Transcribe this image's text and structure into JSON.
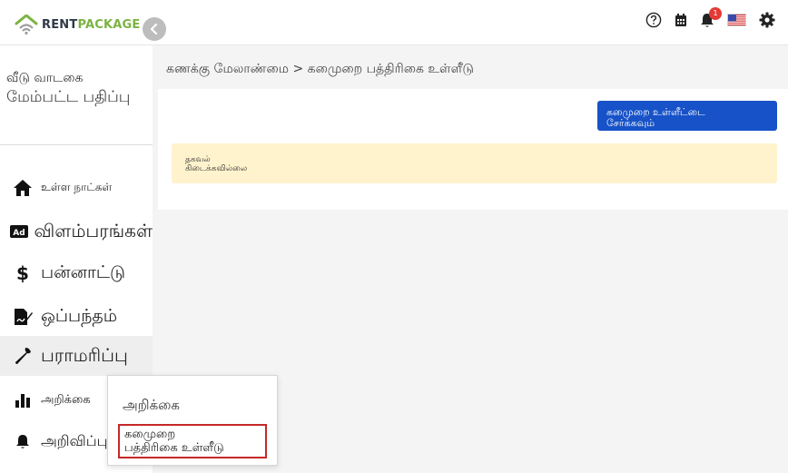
{
  "brand": {
    "rent": "RENT",
    "package": "PACKAGE"
  },
  "header": {
    "notifications_count": "1",
    "icons": [
      "help-circle-icon",
      "calendar-icon",
      "bell-icon",
      "us-flag-icon",
      "gear-icon"
    ]
  },
  "sidebar": {
    "user": {
      "line1": "வீடு வாடகை",
      "line2": "மேம்பட்ட பதிப்பு"
    },
    "items": [
      {
        "label": "உள்ள நாட்கள்",
        "icon": "home-icon"
      },
      {
        "label": "விளம்பரங்கள்",
        "icon": "ad-icon"
      },
      {
        "label": "பன்னாட்டு",
        "icon": "dollar-icon"
      },
      {
        "label": "ஒப்பந்தம்",
        "icon": "contract-icon"
      },
      {
        "label": "பராமரிப்பு",
        "icon": "wrench-icon"
      },
      {
        "label": "அறிக்கை",
        "icon": "bar-chart-icon"
      },
      {
        "label": "அறிவிப்பு",
        "icon": "bell-icon"
      }
    ]
  },
  "main": {
    "breadcrumb": "கணக்கு மேலாண்மை > கமைுறை பத்திரிகை உள்ளீடு",
    "action_button": {
      "line1": "கமைுறை உள்ளீட்டை",
      "line2": "சேர்க்கவும்"
    },
    "alert": {
      "title": "தகவல்",
      "message": "கிடைக்கவில்லை"
    }
  },
  "dropdown": {
    "items": [
      {
        "label": "அறிக்கை"
      },
      {
        "line1": "கமைுறை",
        "line2": "பத்திரிகை உள்ளீடு"
      }
    ]
  },
  "colors": {
    "primary": "#1752c8",
    "alert_bg": "#fff3cd",
    "highlight_border": "#c62828",
    "brand_green": "#7cb342"
  }
}
